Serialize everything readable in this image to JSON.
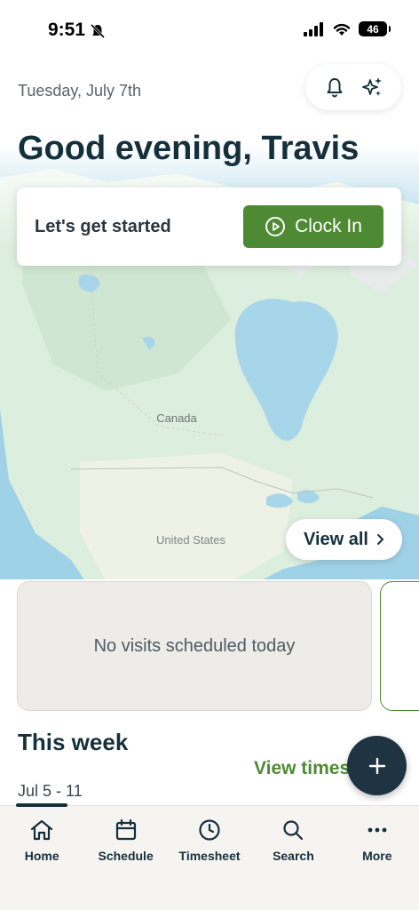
{
  "status_bar": {
    "time": "9:51",
    "battery": "46"
  },
  "header": {
    "date": "Tuesday, July 7th",
    "greeting": "Good evening, Travis"
  },
  "clock_card": {
    "label": "Let's get started",
    "button_label": "Clock In"
  },
  "map": {
    "label_canada": "Canada",
    "label_us": "United States",
    "view_all_label": "View all"
  },
  "visits": {
    "empty_message": "No visits scheduled today"
  },
  "week": {
    "title": "This week",
    "range": "Jul 5 - 11",
    "link_label": "View timesheet"
  },
  "tabs": [
    {
      "label": "Home",
      "icon": "home-icon"
    },
    {
      "label": "Schedule",
      "icon": "calendar-icon"
    },
    {
      "label": "Timesheet",
      "icon": "clock-icon"
    },
    {
      "label": "Search",
      "icon": "search-icon"
    },
    {
      "label": "More",
      "icon": "more-icon"
    }
  ],
  "colors": {
    "accent_green": "#4e8a33",
    "dark_navy": "#15303d",
    "fab": "#1f3442"
  }
}
